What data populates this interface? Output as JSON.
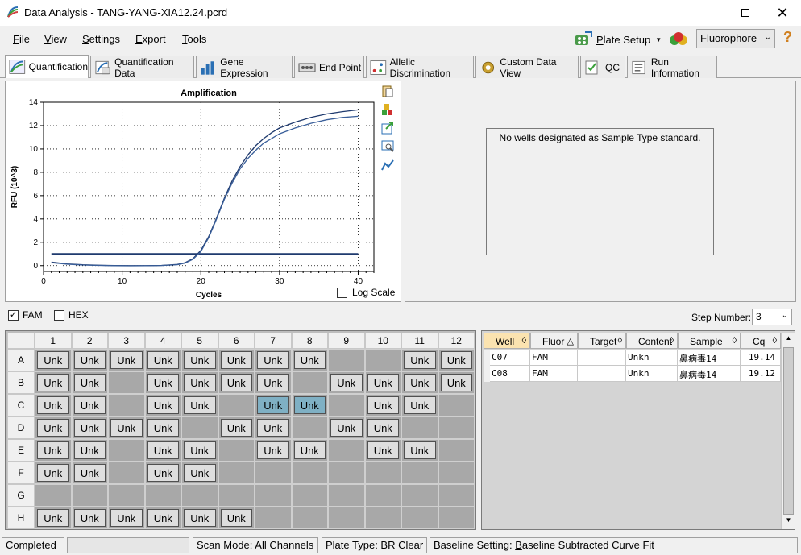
{
  "window": {
    "title": "Data Analysis - TANG-YANG-XIA12.24.pcrd"
  },
  "menu": [
    {
      "label": "File",
      "key": "F",
      "rest": "ile"
    },
    {
      "label": "View",
      "key": "V",
      "rest": "iew"
    },
    {
      "label": "Settings",
      "key": "S",
      "rest": "ettings"
    },
    {
      "label": "Export",
      "key": "E",
      "rest": "xport"
    },
    {
      "label": "Tools",
      "key": "T",
      "rest": "ools"
    }
  ],
  "toolbar": {
    "plate_setup": "Plate Setup",
    "plate_key": "P",
    "plate_rest": "late Setup",
    "fluorophore": "Fluorophore"
  },
  "tabs": [
    {
      "label": "Quantification",
      "icon": "amplification-icon",
      "active": true
    },
    {
      "label": "Quantification Data",
      "icon": "quant-data-icon"
    },
    {
      "label": "Gene Expression",
      "icon": "bar-chart-icon"
    },
    {
      "label": "End Point",
      "icon": "end-point-icon"
    },
    {
      "label": "Allelic Discrimination",
      "icon": "allelic-icon"
    },
    {
      "label": "Custom Data View",
      "icon": "gear-icon"
    },
    {
      "label": "QC",
      "icon": "qc-icon"
    },
    {
      "label": "Run Information",
      "icon": "info-icon"
    }
  ],
  "chart_data": {
    "type": "line",
    "title": "Amplification",
    "xlabel": "Cycles",
    "ylabel": "RFU (10^3)",
    "xlim": [
      0,
      42
    ],
    "ylim": [
      -0.5,
      14
    ],
    "xticks": [
      0,
      10,
      20,
      30,
      40
    ],
    "yticks": [
      0,
      2,
      4,
      6,
      8,
      10,
      12,
      14
    ],
    "grid": true,
    "threshold": 1.0,
    "series": [
      {
        "color": "#1f3a6e",
        "x": [
          1,
          3,
          5,
          7,
          9,
          11,
          13,
          15,
          17,
          18,
          19,
          20,
          21,
          22,
          23,
          24,
          25,
          26,
          27,
          28,
          29,
          30,
          32,
          34,
          36,
          38,
          40
        ],
        "y": [
          0.3,
          0.15,
          0.07,
          0.03,
          0.01,
          0.0,
          0.0,
          0.02,
          0.1,
          0.25,
          0.6,
          1.3,
          2.5,
          4.1,
          5.8,
          7.3,
          8.5,
          9.5,
          10.3,
          10.9,
          11.4,
          11.8,
          12.3,
          12.7,
          13.0,
          13.2,
          13.35
        ]
      },
      {
        "color": "#3a5f9a",
        "x": [
          1,
          3,
          5,
          7,
          9,
          11,
          13,
          15,
          17,
          18,
          19,
          20,
          21,
          22,
          23,
          24,
          25,
          26,
          27,
          28,
          29,
          30,
          32,
          34,
          36,
          38,
          40
        ],
        "y": [
          0.25,
          0.12,
          0.05,
          0.02,
          0.0,
          -0.02,
          -0.01,
          0.01,
          0.08,
          0.22,
          0.55,
          1.2,
          2.4,
          4.0,
          5.7,
          7.1,
          8.3,
          9.2,
          9.9,
          10.5,
          10.9,
          11.3,
          11.8,
          12.2,
          12.5,
          12.7,
          12.8
        ]
      }
    ]
  },
  "chart_options": {
    "log_scale": "Log Scale"
  },
  "standards": {
    "message": "No wells designated as Sample Type standard."
  },
  "filters": {
    "fam": "FAM",
    "hex": "HEX",
    "step_label": "Step Number:",
    "step_value": "3"
  },
  "plate": {
    "columns": [
      "1",
      "2",
      "3",
      "4",
      "5",
      "6",
      "7",
      "8",
      "9",
      "10",
      "11",
      "12"
    ],
    "rows": [
      "A",
      "B",
      "C",
      "D",
      "E",
      "F",
      "G",
      "H"
    ],
    "label": "Unk",
    "wells": [
      [
        1,
        1,
        1,
        1,
        1,
        1,
        1,
        1,
        0,
        0,
        1,
        1
      ],
      [
        1,
        1,
        0,
        1,
        1,
        1,
        1,
        0,
        1,
        1,
        1,
        1
      ],
      [
        1,
        1,
        0,
        1,
        1,
        0,
        2,
        2,
        0,
        1,
        1,
        0
      ],
      [
        1,
        1,
        1,
        1,
        0,
        1,
        1,
        0,
        1,
        1,
        0,
        0
      ],
      [
        1,
        1,
        0,
        1,
        1,
        0,
        1,
        1,
        0,
        1,
        1,
        0
      ],
      [
        1,
        1,
        0,
        1,
        1,
        0,
        0,
        0,
        0,
        0,
        0,
        0
      ],
      [
        0,
        0,
        0,
        0,
        0,
        0,
        0,
        0,
        0,
        0,
        0,
        0
      ],
      [
        1,
        1,
        1,
        1,
        1,
        1,
        0,
        0,
        0,
        0,
        0,
        0
      ]
    ]
  },
  "results": {
    "headers": [
      {
        "label": "Well",
        "sort": "◊",
        "active": true
      },
      {
        "label": "Fluor",
        "sort": "△"
      },
      {
        "label": "Target",
        "sort": "◊"
      },
      {
        "label": "Content",
        "sort": "◊"
      },
      {
        "label": "Sample",
        "sort": "◊"
      },
      {
        "label": "Cq",
        "sort": "◊"
      }
    ],
    "rows": [
      [
        "C07",
        "FAM",
        "",
        "Unkn",
        "鼻病毒14",
        "19.14"
      ],
      [
        "C08",
        "FAM",
        "",
        "Unkn",
        "鼻病毒14",
        "19.12"
      ]
    ]
  },
  "status": {
    "state": "Completed",
    "scan_mode": "Scan Mode: All Channels",
    "plate_type": "Plate Type: BR Clear",
    "baseline_label": "Baseline Setting: ",
    "baseline_key": "B",
    "baseline_rest": "aseline Subtracted Curve Fit"
  }
}
